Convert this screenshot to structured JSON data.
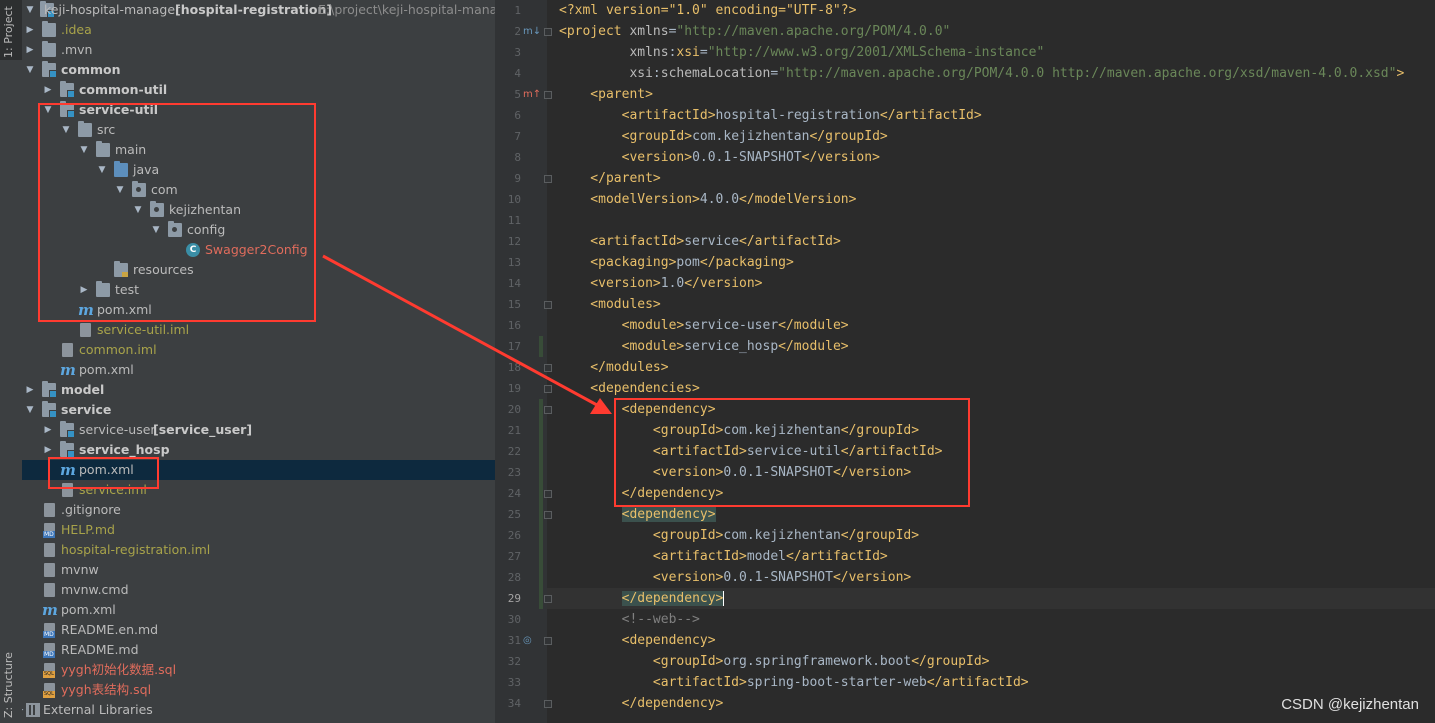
{
  "toolstrip": {
    "project_tab": "1: Project",
    "structure_tab": "Z: Structure"
  },
  "project_tree": {
    "root_name": "keji-hospital-manager",
    "root_module": "[hospital-registration]",
    "root_path": "E:\\project\\keji-hospital-manag",
    "items": [
      {
        "label": "keji-hospital-manager"
      },
      {
        "label": ".idea"
      },
      {
        "label": ".mvn"
      },
      {
        "label": "common"
      },
      {
        "label": "common-util"
      },
      {
        "label": "service-util"
      },
      {
        "label": "src"
      },
      {
        "label": "main"
      },
      {
        "label": "java"
      },
      {
        "label": "com"
      },
      {
        "label": "kejizhentan"
      },
      {
        "label": "config"
      },
      {
        "label": "Swagger2Config"
      },
      {
        "label": "resources"
      },
      {
        "label": "test"
      },
      {
        "label": "pom.xml"
      },
      {
        "label": "service-util.iml"
      },
      {
        "label": "common.iml"
      },
      {
        "label": "pom.xml"
      },
      {
        "label": "model"
      },
      {
        "label": "service"
      },
      {
        "label": "service-user",
        "extra": "[service_user]"
      },
      {
        "label": "service_hosp"
      },
      {
        "label": "pom.xml"
      },
      {
        "label": "service.iml"
      },
      {
        "label": ".gitignore"
      },
      {
        "label": "HELP.md"
      },
      {
        "label": "hospital-registration.iml"
      },
      {
        "label": "mvnw"
      },
      {
        "label": "mvnw.cmd"
      },
      {
        "label": "pom.xml"
      },
      {
        "label": "README.en.md"
      },
      {
        "label": "README.md"
      },
      {
        "label": "yygh初始化数据.sql"
      },
      {
        "label": "yygh表结构.sql"
      },
      {
        "label": "External Libraries"
      }
    ]
  },
  "editor": {
    "line_numbers": [
      "1",
      "2",
      "3",
      "4",
      "5",
      "6",
      "7",
      "8",
      "9",
      "10",
      "11",
      "12",
      "13",
      "14",
      "15",
      "16",
      "17",
      "18",
      "19",
      "20",
      "21",
      "22",
      "23",
      "24",
      "25",
      "26",
      "27",
      "28",
      "29",
      "30",
      "31",
      "32",
      "33",
      "34"
    ],
    "current_line": "29",
    "lines": {
      "l1": [
        "<?xml version=\"1.0\" encoding=\"UTF-8\"?>"
      ],
      "l2": [
        "<project",
        " xmlns",
        "=",
        "\"http://maven.apache.org/POM/4.0.0\""
      ],
      "l3": [
        "         xmlns",
        ":",
        "xsi",
        "=",
        "\"http://www.w3.org/2001/XMLSchema-instance\""
      ],
      "l4": [
        "         xsi",
        ":",
        "schemaLocation",
        "=",
        "\"http://maven.apache.org/POM/4.0.0 http://maven.apache.org/xsd/maven-4.0.0.xsd\"",
        ">"
      ],
      "l5": [
        "    <parent>"
      ],
      "l6": [
        "        <artifactId>",
        "hospital-registration",
        "</artifactId>"
      ],
      "l7": [
        "        <groupId>",
        "com.kejizhentan",
        "</groupId>"
      ],
      "l8": [
        "        <version>",
        "0.0.1-SNAPSHOT",
        "</version>"
      ],
      "l9": [
        "    </parent>"
      ],
      "l10": [
        "    <modelVersion>",
        "4.0.0",
        "</modelVersion>"
      ],
      "l11": [
        ""
      ],
      "l12": [
        "    <artifactId>",
        "service",
        "</artifactId>"
      ],
      "l13": [
        "    <packaging>",
        "pom",
        "</packaging>"
      ],
      "l14": [
        "    <version>",
        "1.0",
        "</version>"
      ],
      "l15": [
        "    <modules>"
      ],
      "l16": [
        "        <module>",
        "service-user",
        "</module>"
      ],
      "l17": [
        "        <module>",
        "service_hosp",
        "</module>"
      ],
      "l18": [
        "    </modules>"
      ],
      "l19": [
        "    <dependencies>"
      ],
      "l20": [
        "        <dependency>"
      ],
      "l21": [
        "            <groupId>",
        "com.kejizhentan",
        "</groupId>"
      ],
      "l22": [
        "            <artifactId>",
        "service-util",
        "</artifactId>"
      ],
      "l23": [
        "            <version>",
        "0.0.1-SNAPSHOT",
        "</version>"
      ],
      "l24": [
        "        </dependency>"
      ],
      "l25": [
        "        ",
        "<dependency>"
      ],
      "l26": [
        "            <groupId>",
        "com.kejizhentan",
        "</groupId>"
      ],
      "l27": [
        "            <artifactId>",
        "model",
        "</artifactId>"
      ],
      "l28": [
        "            <version>",
        "0.0.1-SNAPSHOT",
        "</version>"
      ],
      "l29": [
        "        ",
        "</dependency>"
      ],
      "l30": [
        "        <!--web-->"
      ],
      "l31": [
        "        <dependency>"
      ],
      "l32": [
        "            <groupId>",
        "org.springframework.boot",
        "</groupId>"
      ],
      "l33": [
        "            <artifactId>",
        "spring-boot-starter-web",
        "</artifactId>"
      ],
      "l34": [
        "        </dependency>"
      ]
    }
  },
  "watermark": "CSDN @kejizhentan",
  "colors": {
    "annotation_red": "#ff3b30",
    "tag": "#e8bf6a",
    "string": "#6a8759",
    "text": "#a9b7c6"
  }
}
